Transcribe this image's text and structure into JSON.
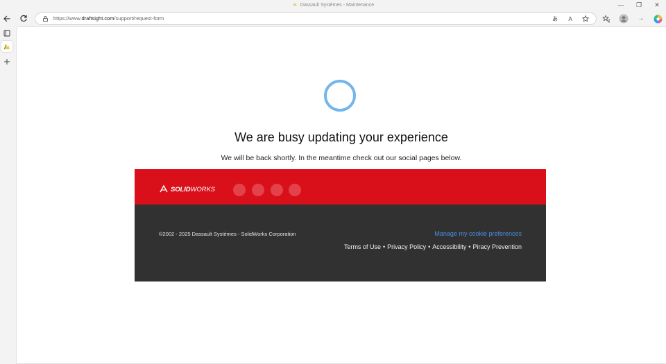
{
  "window": {
    "title": "Dassault Systèmes - Maintenance",
    "controls": {
      "minimize": "—",
      "restore": "❐",
      "close": "✕"
    }
  },
  "toolbar": {
    "url_scheme": "https://www.",
    "url_host": "draftsight.com",
    "url_path": "/support/request-form",
    "icons": [
      "back-icon",
      "refresh-icon",
      "lock-icon",
      "translate-icon",
      "read-aloud-icon",
      "favorite-star-icon",
      "favorites-icon",
      "profile-icon",
      "more-icon",
      "copilot-icon"
    ],
    "translate_glyph": "あ",
    "read_aloud_glyph": "A",
    "more_glyph": "···"
  },
  "sidebar": {
    "icons": [
      "tab-actions-icon",
      "draftsight-tab-icon",
      "new-tab-icon"
    ]
  },
  "page": {
    "headline": "We are busy updating your experience",
    "subline": "We will be back shortly. In the meantime check out our social pages below.",
    "spinner_color": "#72b6ec"
  },
  "footer": {
    "brand_prefix": "SOLID",
    "brand_suffix": "WORKS",
    "brand_color": "#d9101a",
    "social_links": [
      "",
      "",
      "",
      ""
    ],
    "copyright": "©2002 - 2025 Dassault Systèmes - SolidWorks Corporation",
    "cookie_icon": "",
    "cookie_label": "Manage my cookie preferences",
    "legal_links": [
      "Terms of Use",
      "Privacy Policy",
      "Accessibility",
      "Piracy Prevention"
    ],
    "legal_separator": "•"
  }
}
